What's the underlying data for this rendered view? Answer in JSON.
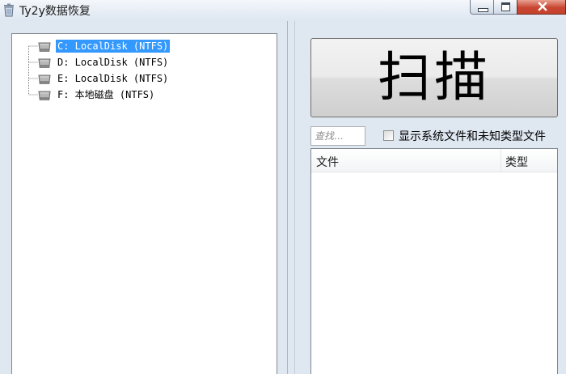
{
  "window": {
    "title": "Ty2y数据恢复"
  },
  "icons": {
    "app": "recycle-bin-icon",
    "drive": "hard-drive-icon",
    "minimize": "minimize-icon",
    "maximize": "maximize-icon",
    "close": "close-icon"
  },
  "colors": {
    "selection": "#3399ff",
    "close_button": "#c84632"
  },
  "tree": {
    "items": [
      {
        "label": "C: LocalDisk (NTFS)",
        "selected": true
      },
      {
        "label": "D: LocalDisk (NTFS)",
        "selected": false
      },
      {
        "label": "E: LocalDisk (NTFS)",
        "selected": false
      },
      {
        "label": "F: 本地磁盘 (NTFS)",
        "selected": false
      }
    ]
  },
  "scan": {
    "label": "扫描"
  },
  "search": {
    "placeholder": "查找..."
  },
  "options": {
    "show_system_label": "显示系统文件和未知类型文件",
    "show_system_checked": false
  },
  "file_list": {
    "columns": [
      "文件",
      "类型"
    ]
  }
}
